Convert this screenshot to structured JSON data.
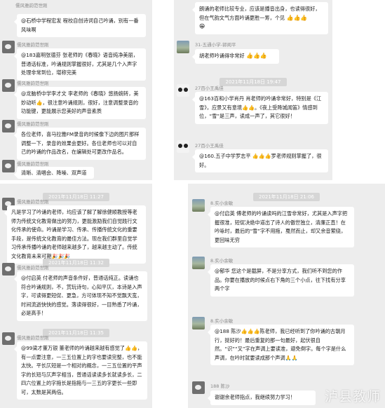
{
  "panels": {
    "tl": {
      "top_name": "儒风雅韵范世刚",
      "messages": [
        {
          "text": "@石桥中学程宏发 程校自创诗词自己吟诵，别有一番风味啊"
        },
        {
          "name": "儒风雅韵范世刚",
          "text": "@183嘉明张德芬 张老师的《春晓》语音纯净美丽，普通话标准，吟诵规则掌握很好，尤其是几个入声字处理非常到位，堪称完美"
        },
        {
          "name": "儒风雅韵范世刚",
          "text": "@龙脑桥中学李才文 李老师的《春晓》悠扬婉转，美妙动听👍，很注意吟诵规则，很好，注意调整录音的功能键，更能展示您美好的声音素质"
        },
        {
          "name": "儒风雅韵范世刚",
          "text": "各位老师，喜马拉雅FM录音的时候像下边的图片那样调整一下，录音的效果会更好。各位老师也可以对自己的吟诵的作品改名，在编辑处可更改作品名。"
        },
        {
          "name": "儒风雅韵范世刚",
          "text": "清晰、清唱会、降噪、双声道"
        }
      ]
    },
    "tr": {
      "messages": [
        {
          "text": "朗诵的老师比较专业，应该是播音出身，也读得很好，但在气韵文气方面吟诵更胜一筹，个见"
        },
        {
          "name": "31-五通小学-郭闺平",
          "text": "胡老师吟诵得非常好"
        },
        {
          "timestamp": "2021年11月18日 19:47",
          "name": "27百小王禹佳",
          "text": "@163百和小学肖丹 肖老师的吟诵非常好，特别是《江雪》，应景又有意境👍👍。《夜上受降城闻笛》情感到位，“雪”是三声，读成一声了，其它很好！"
        },
        {
          "name": "27百小王禹佳",
          "text": "@160.五子中学罗志平 👍👍👍罗老师规则掌握了，很好。"
        }
      ]
    },
    "bl": {
      "messages": [
        {
          "timestamp": "2021年11月18日 11:27",
          "name": "儒风雅韵范世刚",
          "text": "凡是学习了吟诵的老师，均应该了解了解徐健顺教授等老师为传统文化教育做出的努力，更能激励我们自觉践行文化传承的使命。吟诵是学习、传承、传播传统文化的重要手段，是传统文化教育的最佳方法。现在我们群里自觉学习传承传播吟诵的老师越来越多了，越来越主动了。传统文化教育未来可期🎉🎉🎉"
        },
        {
          "timestamp": "2021年11月18日 11:32",
          "name": "儒风雅韵范世刚",
          "text": "@付启英 付老师的声音条件好，普通话纯正。读诵也符合吟诵规则，不，赏玩诗句，心知平仄，本诗是入声字，可读得更短促、更急，方可体现不知不觉飘天宽，时间流逝快快的感觉。落读得很好，一目熟悉了吟诵，必是高手！"
        },
        {
          "timestamp": "2021年11月18日 11:35",
          "name": "儒风雅韵范世刚",
          "text": "@99梁才董万银 董老师的吟诵越来越有感觉了👍👍，有一点要注意，一三五位置上的字也要读完整，也不能太快。平长仄短是一个相对的概念，一三五位置的平声字的长短与仄声字相当，普通话读读多长就读多长，二四六位置上的字拖长是指拖与一三五的字更长一些即可，太数是其两倍。"
        }
      ]
    },
    "br": {
      "timestamp_top": "2021年11月18日 21:06",
      "messages": [
        {
          "name": "8.实小余敏",
          "text": "@付启英 傅老师的吟诵读吗的江雪非常好，尤其是入声字把握很准，短促决绝中道出了诗人的傲世独立，清廉正直！在吟咏时，最后的“雪”字不用拖，戛然而止，却又余音萦绕，更回味无穷"
        },
        {
          "name": "8.实小余敏",
          "text": "@郁华 您这个是截屏，不是分享方式，我们听不到您的作品。你要在播放的时候点右下角的三个小点，往下找有分享两个字"
        },
        {
          "name": "8.实小余敏",
          "text": "@188 陈沙👍👍👍陈老师，我已经听到了你吟诵的古朝月行，挺好的！最后重复的那一句最好，起伏很自然。“识”“叉”字在声调上要读准，避免倒字。每个字是什么声调，在吟时就要读成那个声调🙏🙏"
        },
        {
          "name": "188 陈沙",
          "text": "谢谢余老师指点，我继续努力学习！"
        }
      ],
      "watermark": "泸县教师"
    }
  },
  "colors": {
    "panel_bg": "#ededed",
    "bubble": "#ffffff",
    "timestamp_bg": "#d6d6d6",
    "name": "#8a8a8a"
  }
}
